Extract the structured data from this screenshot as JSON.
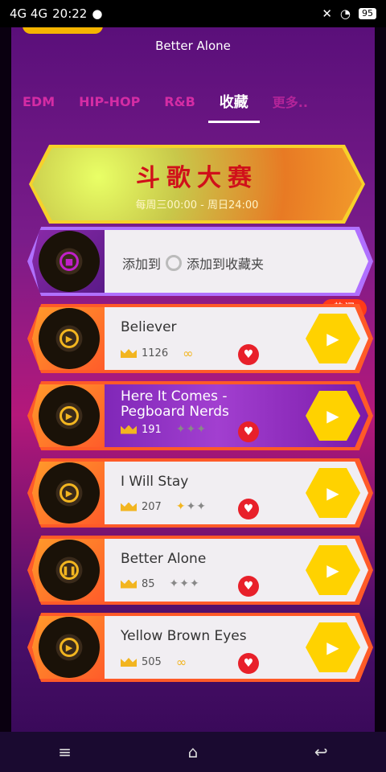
{
  "status_bar": {
    "network": "4G 4G",
    "time": "20:22",
    "battery": "95"
  },
  "header": {
    "title": "Better Alone"
  },
  "tabs": [
    {
      "label": "EDM",
      "active": false
    },
    {
      "label": "HIP-HOP",
      "active": false
    },
    {
      "label": "R&B",
      "active": false
    },
    {
      "label": "收藏",
      "active": true
    },
    {
      "label": "更多..",
      "active": false
    }
  ],
  "banner": {
    "title": "斗歌大赛",
    "subtitle": "每周三00:00 - 周日24:00"
  },
  "add_row": {
    "prefix": "添加到",
    "label": "添加到收藏夹"
  },
  "hot_badge": "热门",
  "songs": [
    {
      "title": "Believer",
      "count": "1126"
    },
    {
      "title": "Here It Comes - Pegboard Nerds",
      "count": "191"
    },
    {
      "title": "I Will Stay",
      "count": "207"
    },
    {
      "title": "Better Alone",
      "count": "85"
    },
    {
      "title": "Yellow Brown Eyes",
      "count": "505"
    }
  ],
  "colors": {
    "accent": "#ffd200",
    "heart": "#e8202a",
    "hot": "#ff3a18",
    "banner_title": "#d0101a"
  }
}
